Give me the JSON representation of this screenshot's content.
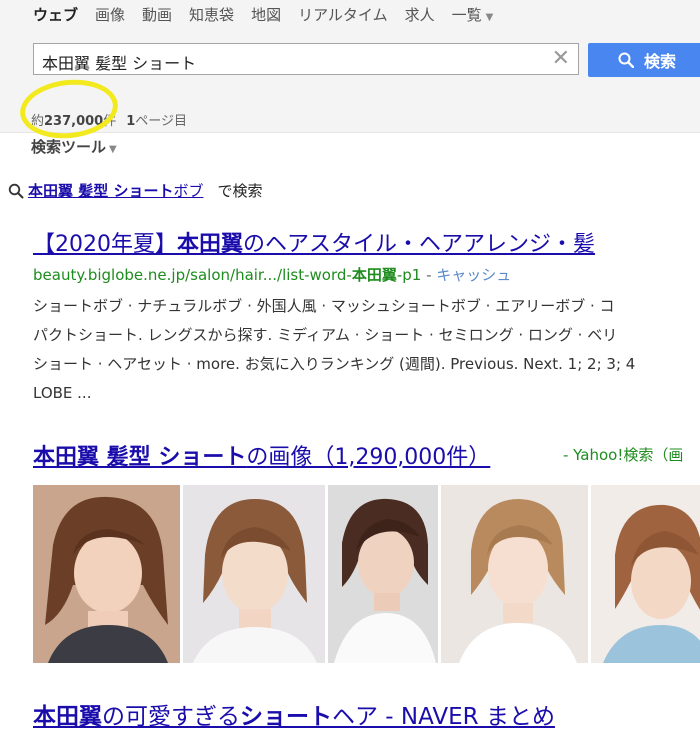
{
  "tabs": [
    {
      "label": "ウェブ"
    },
    {
      "label": "画像"
    },
    {
      "label": "動画"
    },
    {
      "label": "知恵袋"
    },
    {
      "label": "地図"
    },
    {
      "label": "リアルタイム"
    },
    {
      "label": "求人"
    },
    {
      "label": "一覧"
    }
  ],
  "search": {
    "query": "本田翼 髪型 ショート",
    "button_label": "検索",
    "clear_symbol": "✕"
  },
  "stats": {
    "prefix": "約",
    "count": "237,000",
    "suffix": "件",
    "page_num": "1",
    "page_label": "ページ目"
  },
  "tools_label": "検索ツール",
  "suggestion": {
    "bold": "本田翼 髪型 ショート",
    "rest": "ボブ",
    "tail": "で検索"
  },
  "result1": {
    "title_pre": "【2020年夏】",
    "title_bold": "本田翼",
    "title_post": "のヘアスタイル・ヘアアレンジ・髪",
    "url_pre": "beauty.biglobe.ne.jp/salon/hair.../list-word-",
    "url_bold": "本田翼",
    "url_post": "-p1",
    "separator": " - ",
    "cache": "キャッシュ",
    "snippet": [
      "ショートボブ · ナチュラルボブ · 外国人風 · マッシュショートボブ · エアリーボブ · コ",
      "パクトショート. レングスから探す. ミディアム · ショート · セミロング · ロング · ベリ",
      "ショート · ヘアセット · more. お気に入りランキング (週間). Previous. Next. 1; 2; 3; 4",
      "LOBE ..."
    ]
  },
  "images": {
    "title_bold": "本田翼 髪型 ショート",
    "title_post": "の画像（1,290,000件）",
    "source": "- Yahoo!検索（画"
  },
  "result2": {
    "title_bold1": "本田翼",
    "title_mid": "の可愛すぎる",
    "title_bold2": "ショート",
    "title_post": "ヘア - NAVER まとめ"
  },
  "colors": {
    "link": "#1a0dab",
    "url_green": "#1e8c1e",
    "search_button": "#4a86f0",
    "highlight": "#f2ea1e"
  }
}
